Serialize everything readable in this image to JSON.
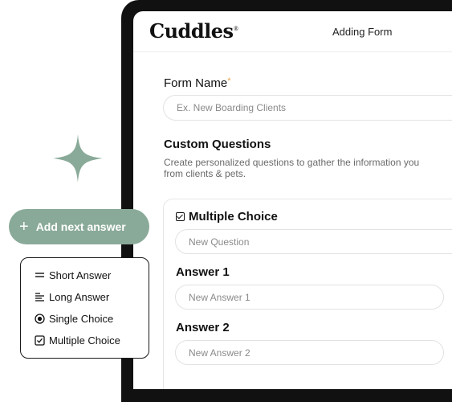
{
  "header": {
    "brand": "Cuddles",
    "brand_mark": "®",
    "title": "Adding Form"
  },
  "form": {
    "name_label": "Form Name",
    "required_mark": "*",
    "name_placeholder": "Ex. New Boarding Clients"
  },
  "custom_questions": {
    "title": "Custom Questions",
    "description": "Create personalized questions to gather the information you\nfrom clients & pets."
  },
  "question_card": {
    "type_label": "Multiple Choice",
    "question_placeholder": "New Question",
    "answers": [
      {
        "label": "Answer 1",
        "placeholder": "New Answer 1"
      },
      {
        "label": "Answer 2",
        "placeholder": "New Answer 2"
      }
    ]
  },
  "add_button": {
    "label": "Add next answer",
    "icon": "plus-icon"
  },
  "type_menu": {
    "items": [
      {
        "label": "Short Answer",
        "icon": "short-lines-icon"
      },
      {
        "label": "Long Answer",
        "icon": "long-lines-icon"
      },
      {
        "label": "Single Choice",
        "icon": "radio-icon"
      },
      {
        "label": "Multiple Choice",
        "icon": "checkbox-icon"
      }
    ]
  },
  "colors": {
    "accent": "#8aaa99",
    "required": "#e8a44a",
    "frame": "#111111"
  }
}
